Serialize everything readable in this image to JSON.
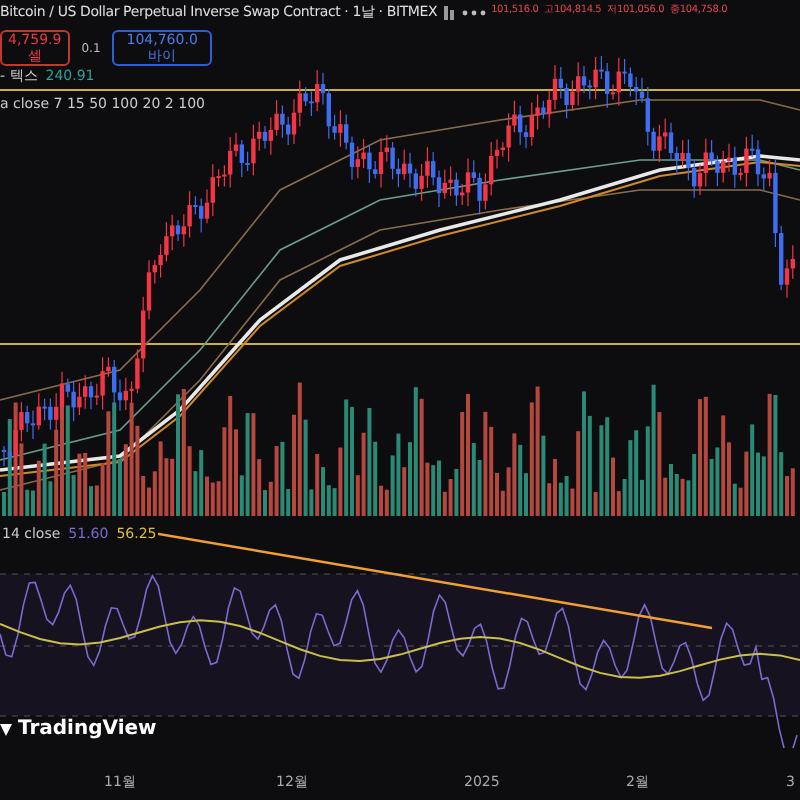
{
  "header": {
    "title": "Bitcoin / US Dollar Perpetual Inverse Swap Contract · 1날 · BITMEX",
    "ohlc": [
      "101,516.0",
      "고104,814.5",
      "저101,056.0",
      "종104,758.0"
    ]
  },
  "trade": {
    "sell_price": "4,759.9",
    "sell_label": "셀",
    "spread": "0.1",
    "buy_price": "104,760.0",
    "buy_label": "바이"
  },
  "indicators": [
    {
      "name": "- 텍스",
      "value": "240.91"
    },
    {
      "name": "a close 7 15 50 100 20 2 100"
    }
  ],
  "rsi": {
    "name": "14 close",
    "values": [
      "51.60",
      "56.25"
    ]
  },
  "logo": "TradingView",
  "x_axis": [
    "11월",
    "12월",
    "2025",
    "2월",
    "3"
  ]
}
